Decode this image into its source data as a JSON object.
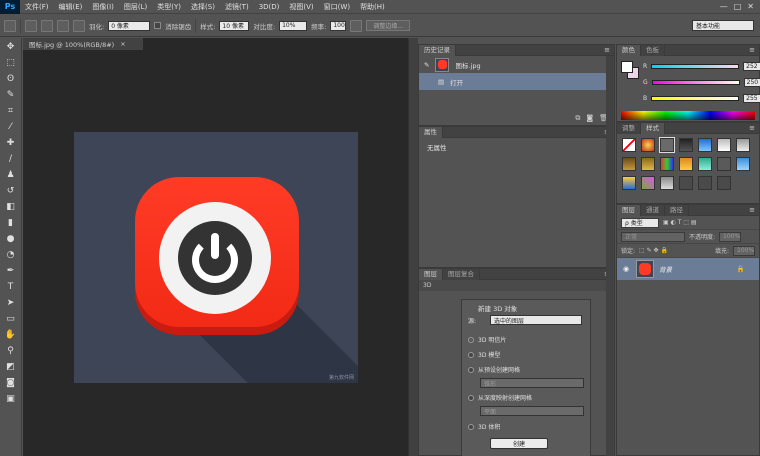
{
  "app": {
    "logo": "Ps",
    "menu": [
      "文件(F)",
      "编辑(E)",
      "图像(I)",
      "图层(L)",
      "类型(Y)",
      "选择(S)",
      "滤镜(T)",
      "3D(D)",
      "视图(V)",
      "窗口(W)",
      "帮助(H)"
    ],
    "window_controls": [
      "—",
      "□",
      "✕"
    ]
  },
  "options_bar": {
    "feather_label": "羽化:",
    "feather_value": "0 像素",
    "antialias_label": "消除锯齿",
    "style_label": "样式:",
    "style_value": "10 像素",
    "ratio_label": "对比度:",
    "ratio_value": "10%",
    "freq_label": "频率:",
    "freq_value": "100",
    "refine_button": "调整边缘...",
    "workspace": "基本功能"
  },
  "document": {
    "tab_title": "图标.jpg @ 100%(RGB/8#)",
    "tab_close": "×",
    "watermark": "第九软件网"
  },
  "history": {
    "tabs": [
      "历史记录"
    ],
    "rows": [
      {
        "label": "图标.jpg"
      },
      {
        "label": "打开"
      }
    ]
  },
  "properties": {
    "tabs": [
      "属性"
    ],
    "label": "无属性"
  },
  "panel3d": {
    "tabs": [
      "图层",
      "图层复合"
    ],
    "sub": "3D",
    "title": "新建 3D 对象",
    "source_label": "源:",
    "source_value": "选中的图层",
    "options": [
      {
        "label": "3D 明信片",
        "selected": true
      },
      {
        "label": "3D 模型",
        "selected": false
      },
      {
        "label": "从预设创建网格",
        "selected": false
      },
      {
        "label": "从深度映射创建网格",
        "selected": false
      },
      {
        "label": "3D 体积",
        "selected": false
      }
    ],
    "preset_value": "锥形",
    "depth_value": "平面",
    "create_button": "创建"
  },
  "color": {
    "tabs": [
      "颜色",
      "色板"
    ],
    "channels": [
      {
        "label": "R",
        "value": "252",
        "gradient": "linear-gradient(90deg,#00d5ec,#ffd5ec)"
      },
      {
        "label": "G",
        "value": "250",
        "gradient": "linear-gradient(90deg,#fc00ec,#fcffec)"
      },
      {
        "label": "B",
        "value": "255",
        "gradient": "linear-gradient(90deg,#fcfa00,#fcfaff)"
      }
    ]
  },
  "styles": {
    "tabs": [
      "调整",
      "样式"
    ]
  },
  "layers": {
    "tabs": [
      "图层",
      "通道",
      "路径"
    ],
    "filter_label": "ρ 类型",
    "blend_mode": "正常",
    "opacity_label": "不透明度:",
    "opacity_value": "100%",
    "lock_label": "锁定:",
    "fill_label": "填充:",
    "fill_value": "100%",
    "layer_name": "背景",
    "lock_icon": "🔒"
  },
  "colors": {
    "accent_selected": "#6b7c96",
    "icon_red": "#ff3b26",
    "canvas_bg": "#3d4556"
  }
}
